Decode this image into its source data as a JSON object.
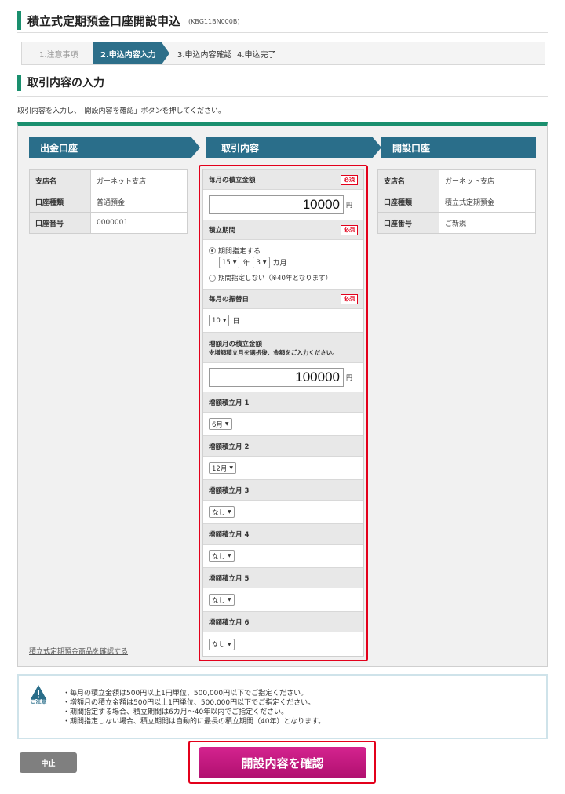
{
  "header": {
    "title": "積立式定期預金口座開設申込",
    "screen_code": "(KBG11BN000B)"
  },
  "steps": [
    "1.注意事項",
    "2.申込内容入力",
    "3.申込内容確認",
    "4.申込完了"
  ],
  "section": {
    "title": "取引内容の入力",
    "instruction": "取引内容を入力し、「開設内容を確認」ボタンを押してください。"
  },
  "withdrawal": {
    "header": "出金口座",
    "rows": [
      {
        "label": "支店名",
        "value": "ガーネット支店"
      },
      {
        "label": "口座種類",
        "value": "普通預金"
      },
      {
        "label": "口座番号",
        "value": "0000001"
      }
    ],
    "product_link": "積立式定期預金商品を確認する"
  },
  "transaction": {
    "header": "取引内容",
    "required_label": "必須",
    "monthly_amount": {
      "label": "毎月の積立金額",
      "value": "10000",
      "unit": "円"
    },
    "period": {
      "label": "積立期間",
      "option_specify": "期間指定する",
      "years": "15",
      "years_unit": "年",
      "months": "3",
      "months_unit": "カ月",
      "option_none": "期間指定しない（※40年となります）"
    },
    "transfer_day": {
      "label": "毎月の振替日",
      "value": "10",
      "unit": "日"
    },
    "bonus_amount": {
      "label": "増額月の積立金額",
      "note": "※増額積立月を選択後、金額をご入力ください。",
      "value": "100000",
      "unit": "円"
    },
    "bonus_months": [
      {
        "label": "増額積立月 1",
        "value": "6月"
      },
      {
        "label": "増額積立月 2",
        "value": "12月"
      },
      {
        "label": "増額積立月 3",
        "value": "なし"
      },
      {
        "label": "増額積立月 4",
        "value": "なし"
      },
      {
        "label": "増額積立月 5",
        "value": "なし"
      },
      {
        "label": "増額積立月 6",
        "value": "なし"
      }
    ]
  },
  "opening": {
    "header": "開設口座",
    "rows": [
      {
        "label": "支店名",
        "value": "ガーネット支店"
      },
      {
        "label": "口座種類",
        "value": "積立式定期預金"
      },
      {
        "label": "口座番号",
        "value": "ご新規"
      }
    ]
  },
  "notes": {
    "label": "ご注意",
    "items": [
      "・毎月の積立金額は500円以上1円単位、500,000円以下でご指定ください。",
      "・増額月の積立金額は500円以上1円単位、500,000円以下でご指定ください。",
      "・期間指定する場合、積立期間は6カ月～40年以内でご指定ください。",
      "・期間指定しない場合、積立期間は自動的に最長の積立期間（40年）となります。"
    ]
  },
  "buttons": {
    "cancel": "中止",
    "confirm": "開設内容を確認"
  },
  "colors": {
    "accent_green": "#1a8f6e",
    "header_blue": "#2a6e8a",
    "required_red": "#e3001b",
    "confirm_magenta": "#c01a80"
  }
}
